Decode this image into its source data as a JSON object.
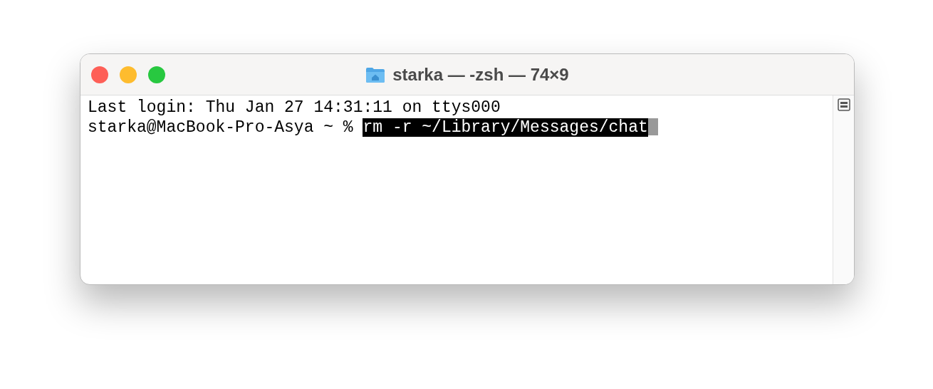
{
  "window": {
    "title": "starka — -zsh — 74×9"
  },
  "terminal": {
    "lines": [
      {
        "kind": "output",
        "text": "Last login: Thu Jan 27 14:31:11 on ttys000"
      },
      {
        "kind": "prompt",
        "prompt": "starka@MacBook-Pro-Asya ~ %",
        "command": "rm -r ~/Library/Messages/chat",
        "selected": true
      }
    ]
  }
}
